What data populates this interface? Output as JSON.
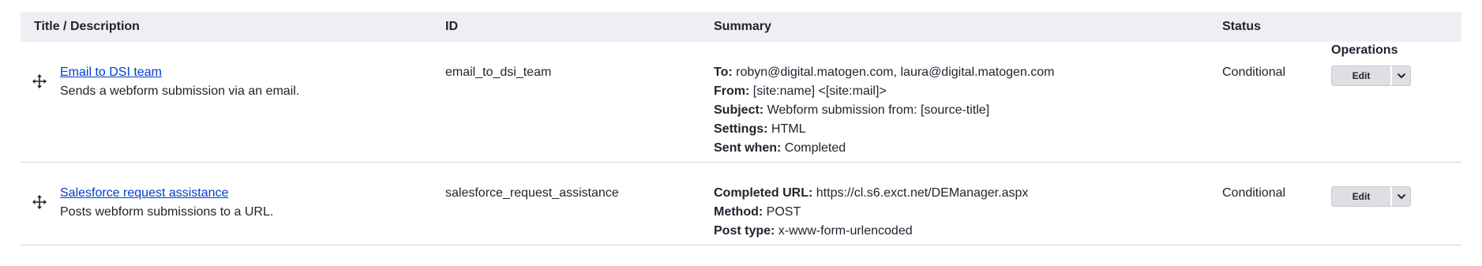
{
  "headers": {
    "title": "Title / Description",
    "id": "ID",
    "summary": "Summary",
    "status": "Status",
    "operations": "Operations"
  },
  "rows": [
    {
      "title": "Email to DSI team",
      "description": "Sends a webform submission via an email.",
      "id": "email_to_dsi_team",
      "summary": [
        {
          "label": "To:",
          "value": "robyn@digital.matogen.com, laura@digital.matogen.com"
        },
        {
          "label": "From:",
          "value": "[site:name] <[site:mail]>"
        },
        {
          "label": "Subject:",
          "value": "Webform submission from: [source-title]"
        },
        {
          "label": "Settings:",
          "value": "HTML"
        },
        {
          "label": "Sent when:",
          "value": "Completed"
        }
      ],
      "status": "Conditional",
      "edit_label": "Edit",
      "drag_icon": "move-arrows-icon",
      "dropdown_icon": "chevron-down-icon"
    },
    {
      "title": "Salesforce request assistance",
      "description": "Posts webform submissions to a URL.",
      "id": "salesforce_request_assistance",
      "summary": [
        {
          "label": "Completed URL:",
          "value": "https://cl.s6.exct.net/DEManager.aspx"
        },
        {
          "label": "Method:",
          "value": "POST"
        },
        {
          "label": "Post type:",
          "value": "x-www-form-urlencoded"
        }
      ],
      "status": "Conditional",
      "edit_label": "Edit",
      "drag_icon": "move-arrows-icon",
      "dropdown_icon": "chevron-down-icon"
    }
  ]
}
